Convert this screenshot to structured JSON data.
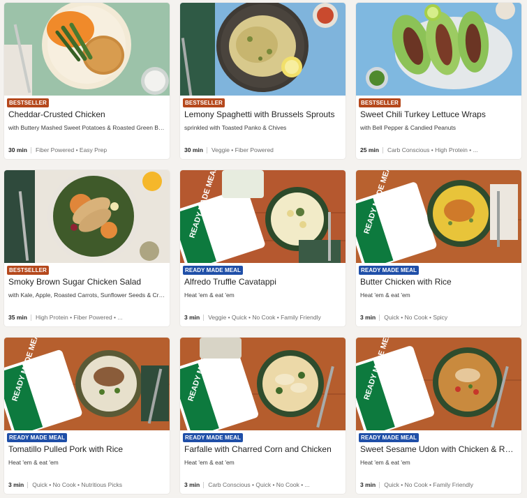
{
  "colors": {
    "bestseller": "#b5481c",
    "ready_made": "#1f4fa8",
    "ready_pack_green": "#0d7a3e"
  },
  "cards": [
    {
      "badge": "BESTSELLER",
      "badge_type": "bestseller",
      "title": "Cheddar-Crusted Chicken",
      "subtitle": "with Buttery Mashed Sweet Potatoes & Roasted Green Beans",
      "time": "30 min",
      "tags": "Fiber Powered • Easy Prep",
      "photo": "cheddar-crusted-chicken-photo"
    },
    {
      "badge": "BESTSELLER",
      "badge_type": "bestseller",
      "title": "Lemony Spaghetti with Brussels Sprouts",
      "subtitle": "sprinkled with Toasted Panko & Chives",
      "time": "30 min",
      "tags": "Veggie • Fiber Powered",
      "photo": "lemony-spaghetti-photo"
    },
    {
      "badge": "BESTSELLER",
      "badge_type": "bestseller",
      "title": "Sweet Chili Turkey Lettuce Wraps",
      "subtitle": "with Bell Pepper & Candied Peanuts",
      "time": "25 min",
      "tags": "Carb Conscious • High Protein • ...",
      "photo": "lettuce-wraps-photo"
    },
    {
      "badge": "BESTSELLER",
      "badge_type": "bestseller",
      "title": "Smoky Brown Sugar Chicken Salad",
      "subtitle": "with Kale, Apple, Roasted Carrots, Sunflower Seeds & Cranberries",
      "time": "35 min",
      "tags": "High Protein • Fiber Powered • ...",
      "photo": "chicken-salad-photo"
    },
    {
      "badge": "READY MADE MEAL",
      "badge_type": "ready_made",
      "title": "Alfredo Truffle Cavatappi",
      "subtitle": "Heat 'em & eat 'em",
      "time": "3 min",
      "tags": "Veggie • Quick • No Cook • Family Friendly",
      "photo": "cavatappi-photo",
      "pack_label": "READY MADE MEALS"
    },
    {
      "badge": "READY MADE MEAL",
      "badge_type": "ready_made",
      "title": "Butter Chicken with Rice",
      "subtitle": "Heat 'em & eat 'em",
      "time": "3 min",
      "tags": "Quick • No Cook • Spicy",
      "photo": "butter-chicken-photo",
      "pack_label": "READY MADE MEALS"
    },
    {
      "badge": "READY MADE MEAL",
      "badge_type": "ready_made",
      "title": "Tomatillo Pulled Pork with Rice",
      "subtitle": "Heat 'em & eat 'em",
      "time": "3 min",
      "tags": "Quick • No Cook • Nutritious Picks",
      "photo": "pulled-pork-photo",
      "pack_label": "READY MADE MEALS"
    },
    {
      "badge": "READY MADE MEAL",
      "badge_type": "ready_made",
      "title": "Farfalle with Charred Corn and Chicken",
      "subtitle": "Heat 'em & eat 'em",
      "time": "3 min",
      "tags": "Carb Conscious • Quick • No Cook • ...",
      "photo": "farfalle-photo",
      "pack_label": "READY MADE MEALS"
    },
    {
      "badge": "READY MADE MEAL",
      "badge_type": "ready_made",
      "title": "Sweet Sesame Udon with Chicken & Red Peppers",
      "subtitle": "Heat 'em & eat 'em",
      "time": "3 min",
      "tags": "Quick • No Cook • Family Friendly",
      "photo": "udon-photo",
      "pack_label": "READY MADE MEALS"
    }
  ]
}
